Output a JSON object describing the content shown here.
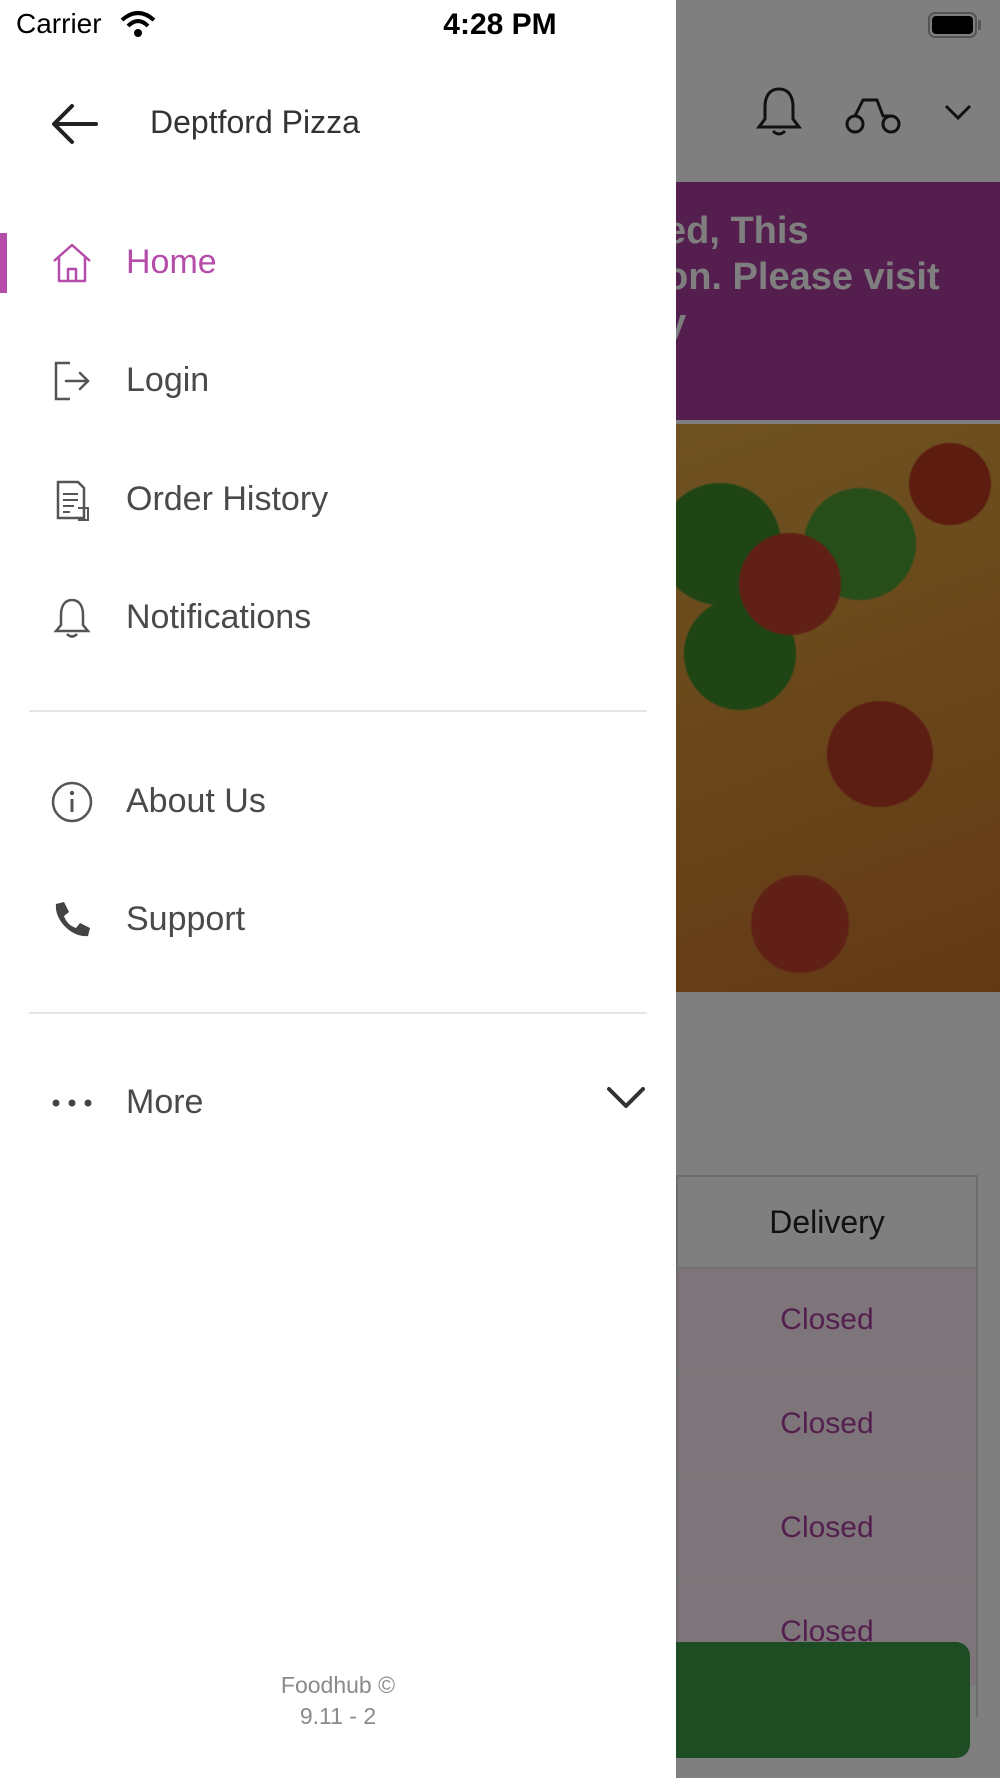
{
  "status_bar": {
    "carrier": "Carrier",
    "time": "4:28 PM"
  },
  "drawer": {
    "title": "Deptford Pizza",
    "items": [
      {
        "label": "Home",
        "icon": "home-icon",
        "active": true
      },
      {
        "label": "Login",
        "icon": "login-icon",
        "active": false
      },
      {
        "label": "Order History",
        "icon": "order-history-icon",
        "active": false
      },
      {
        "label": "Notifications",
        "icon": "bell-icon",
        "active": false
      },
      {
        "label": "About Us",
        "icon": "info-icon",
        "active": false
      },
      {
        "label": "Support",
        "icon": "phone-icon",
        "active": false
      },
      {
        "label": "More",
        "icon": "more-dots-icon",
        "active": false
      }
    ],
    "footer_line1": "Foodhub ©",
    "footer_line2": "9.11 - 2"
  },
  "background": {
    "banner_line1": "ed, This",
    "banner_line2": "on. Please visit",
    "banner_line3": "y",
    "table_header": "Delivery",
    "table_rows": [
      "Closed",
      "Closed",
      "Closed",
      "Closed"
    ]
  },
  "colors": {
    "accent": "#b64ca9",
    "banner": "#a93f9f",
    "cta": "#3d9a46"
  }
}
